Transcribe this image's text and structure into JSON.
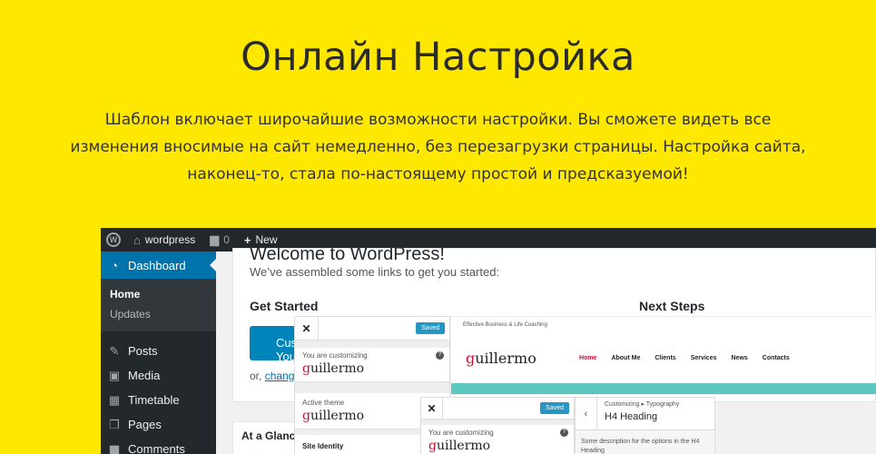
{
  "hero": {
    "title": "Онлайн Настройка",
    "description": "Шаблон включает широчайшие возможности настройки. Вы сможете видеть все изменения вносимые на сайт немедленно, без перезагрузки страницы. Настройка сайта, наконец-то, стала по-настоящему простой и предсказуемой!"
  },
  "colors": {
    "background": "#ffe800",
    "wp_admin": "#23282d",
    "wp_blue": "#0073aa",
    "brand_red": "#c8102e",
    "band_teal": "#5cc7c0"
  },
  "adminbar": {
    "site": "wordpress",
    "comments": "0",
    "new": "New",
    "icons": [
      "wordpress-logo-icon",
      "home-icon",
      "comment-icon",
      "plus-icon"
    ]
  },
  "sidebar": {
    "active": "Dashboard",
    "submenu": [
      "Home",
      "Updates"
    ],
    "items": [
      "Posts",
      "Media",
      "Timetable",
      "Pages",
      "Comments"
    ]
  },
  "welcome": {
    "title": "Welcome to WordPress!",
    "subtitle": "We’ve assembled some links to get you started:",
    "get_started": "Get Started",
    "next_steps": "Next Steps",
    "button": "Customize Your Site",
    "or": "or,",
    "link": "change your theme completely"
  },
  "glance": {
    "title": "At a Glance"
  },
  "customizer1": {
    "saved": "Saved",
    "customizing": "You are customizing",
    "brand_g": "g",
    "brand_rest": "uillermo",
    "active_theme": "Active theme",
    "site_identity": "Site Identity"
  },
  "preview": {
    "tagline": "Effective Business & Life Coaching",
    "nav": [
      "Home",
      "About Me",
      "Clients",
      "Services",
      "News",
      "Contacts"
    ]
  },
  "customizer2": {
    "saved": "Saved",
    "customizing": "You are customizing"
  },
  "typography": {
    "breadcrumb": "Customizing ▸ Typography",
    "title": "H4 Heading",
    "description": "Some description for the options in the H4 Heading"
  }
}
